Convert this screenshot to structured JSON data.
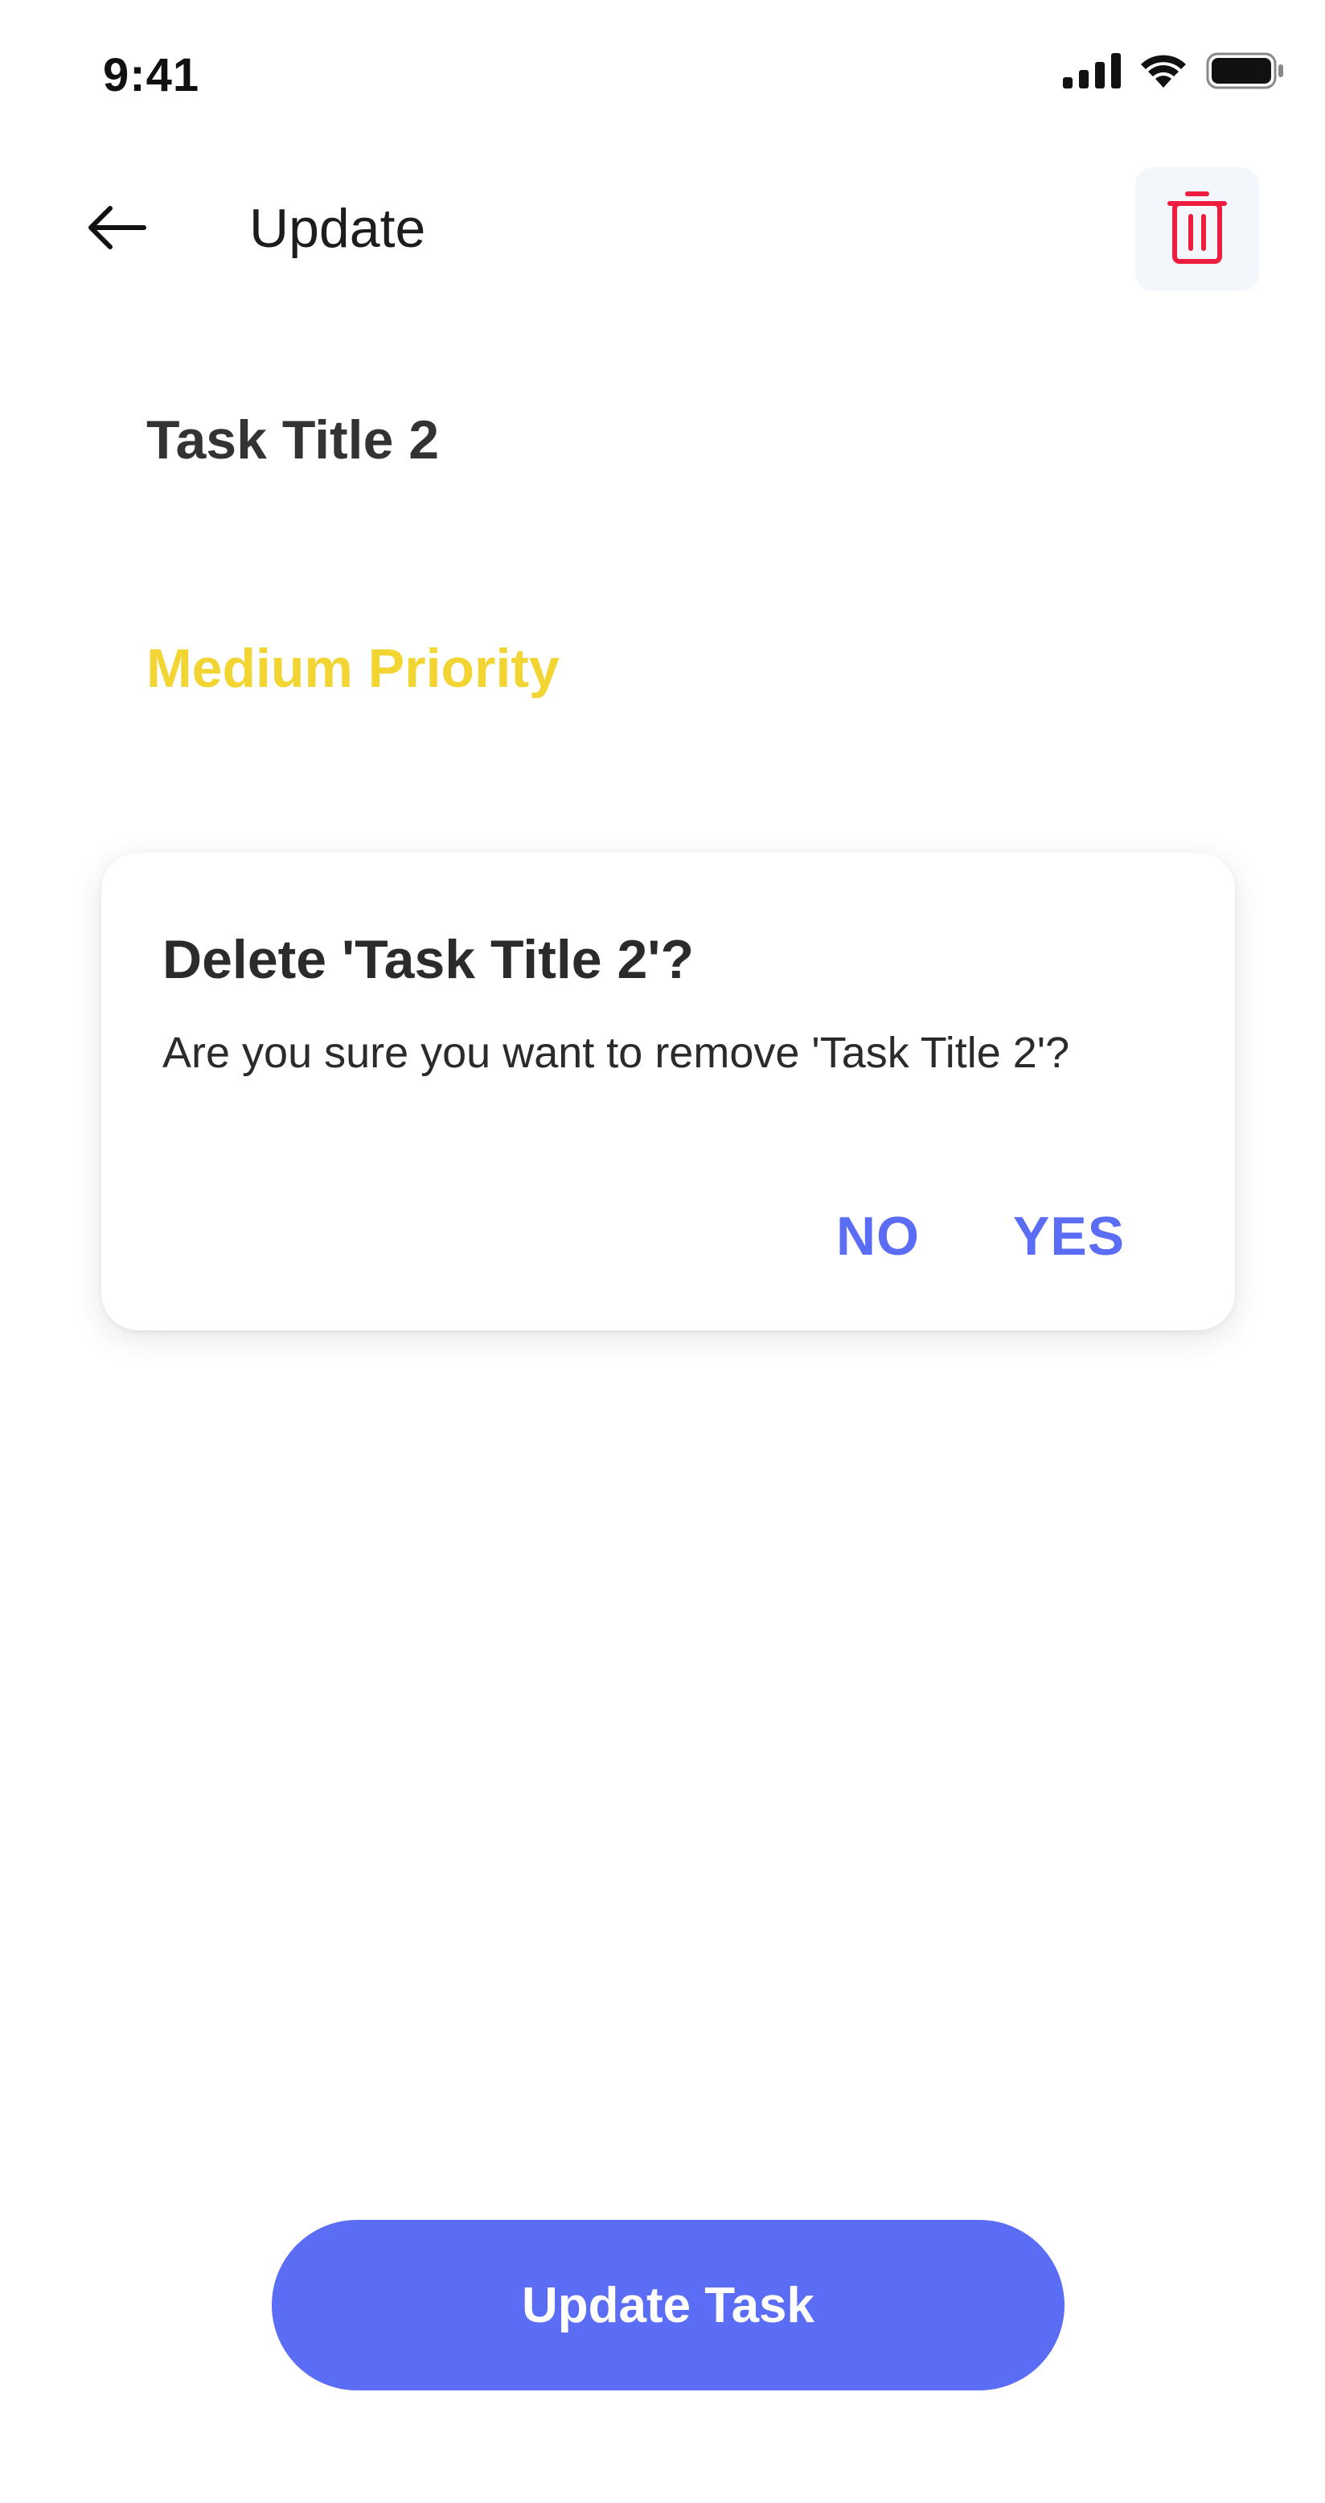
{
  "status_bar": {
    "time": "9:41"
  },
  "header": {
    "title": "Update",
    "back_icon": "arrow-left-icon",
    "delete_icon": "trash-icon"
  },
  "task": {
    "title": "Task Title 2",
    "priority": "Medium Priority"
  },
  "dialog": {
    "title": "Delete 'Task Title 2'?",
    "message": "Are you sure you want to remove 'Task Title 2'?",
    "no_label": "NO",
    "yes_label": "YES"
  },
  "actions": {
    "update_label": "Update Task"
  },
  "colors": {
    "accent": "#5b6cf5",
    "priority_medium": "#f2d532",
    "danger": "#ee1c3f"
  }
}
